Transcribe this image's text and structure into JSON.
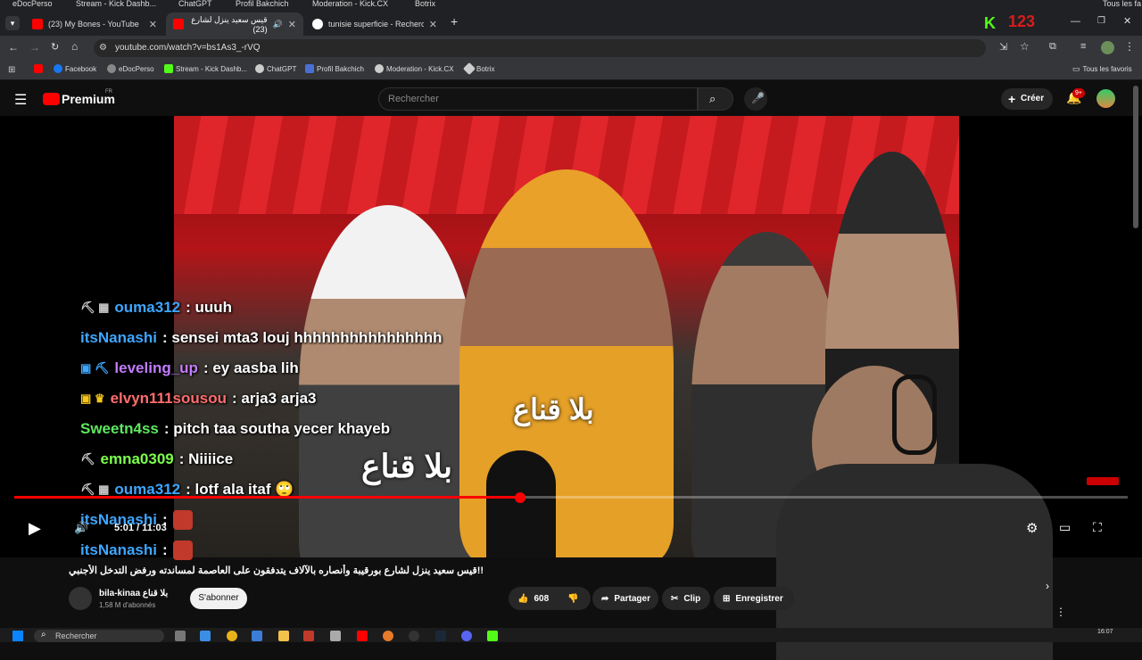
{
  "top_strip": [
    "eDocPerso",
    "Stream - Kick Dashb...",
    "ChatGPT",
    "Profil Bakchich",
    "Moderation - Kick.CX",
    "Botrix",
    "Tous les fa"
  ],
  "overlay": {
    "k_logo": "K",
    "k_number": "123"
  },
  "tabs": [
    {
      "label": "(23) My Bones - YouTube",
      "active": false
    },
    {
      "label": "قيس سعيد ينزل لشارع (23)",
      "active": true
    },
    {
      "label": "tunisie superficie - Recherche G",
      "active": false
    }
  ],
  "address": {
    "url": "youtube.com/watch?v=bs1As3_-rVQ"
  },
  "bookmarks": [
    "Facebook",
    "eDocPerso",
    "Stream - Kick Dashb...",
    "ChatGPT",
    "Profil Bakchich",
    "Moderation - Kick.CX",
    "Botrix"
  ],
  "bookmarks_all": "Tous les favoris",
  "youtube": {
    "logo": "Premium",
    "logo_region": "FR",
    "search_placeholder": "Rechercher",
    "create_label": "Créer",
    "notif_count": "9+"
  },
  "chat": [
    {
      "user": "ouma312",
      "msg": ": uuuh",
      "color": "#3ea6ff",
      "badge": "⛏ ▦"
    },
    {
      "user": "itsNanashi",
      "msg": ": sensei mta3 louj hhhhhhhhhhhhhhhh",
      "color": "#3ea6ff",
      "badge": ""
    },
    {
      "user": "leveling_up",
      "msg": ": ey aasba lih",
      "color": "#c17cff",
      "badge": "▣ ⛏"
    },
    {
      "user": "elvyn111sousou",
      "msg": ": arja3 arja3",
      "color": "#ff6d6d",
      "badge": "▣ ♛"
    },
    {
      "user": "Sweetn4ss",
      "msg": ": pitch taa southa yecer khayeb",
      "color": "#5ee85e",
      "badge": ""
    },
    {
      "user": "emna0309",
      "msg": ": Niiiice",
      "color": "#7cff4d",
      "badge": "⛏"
    },
    {
      "user": "ouma312",
      "msg": ": lotf ala itaf 🙄",
      "color": "#3ea6ff",
      "badge": "⛏ ▦"
    },
    {
      "user": "itsNanashi",
      "msg": ":",
      "color": "#3ea6ff",
      "badge": ""
    },
    {
      "user": "itsNanashi",
      "msg": ":",
      "color": "#3ea6ff",
      "badge": ""
    },
    {
      "user": "itsNanashi",
      "msg": ":",
      "color": "#3ea6ff",
      "badge": ""
    }
  ],
  "video_text": [
    "بلا قناع",
    "بلا قناع"
  ],
  "player": {
    "time": "5:01 / 11:03",
    "progress": 0.454
  },
  "video": {
    "title": "!!قيس سعيد ينزل لشارع بورقيبة وأنصاره بالآلاف يتدفقون على العاصمة لمساندته ورفض التدخل الأجنبي",
    "channel": "bila-kinaa بلا قناع",
    "subscribers": "1,58 M d'abonnés",
    "subscribe_label": "S'abonner",
    "likes": "608",
    "share_label": "Partager",
    "clip_label": "Clip",
    "save_label": "Enregistrer"
  },
  "taskbar": {
    "search_label": "Rechercher",
    "clock": "16:07"
  }
}
